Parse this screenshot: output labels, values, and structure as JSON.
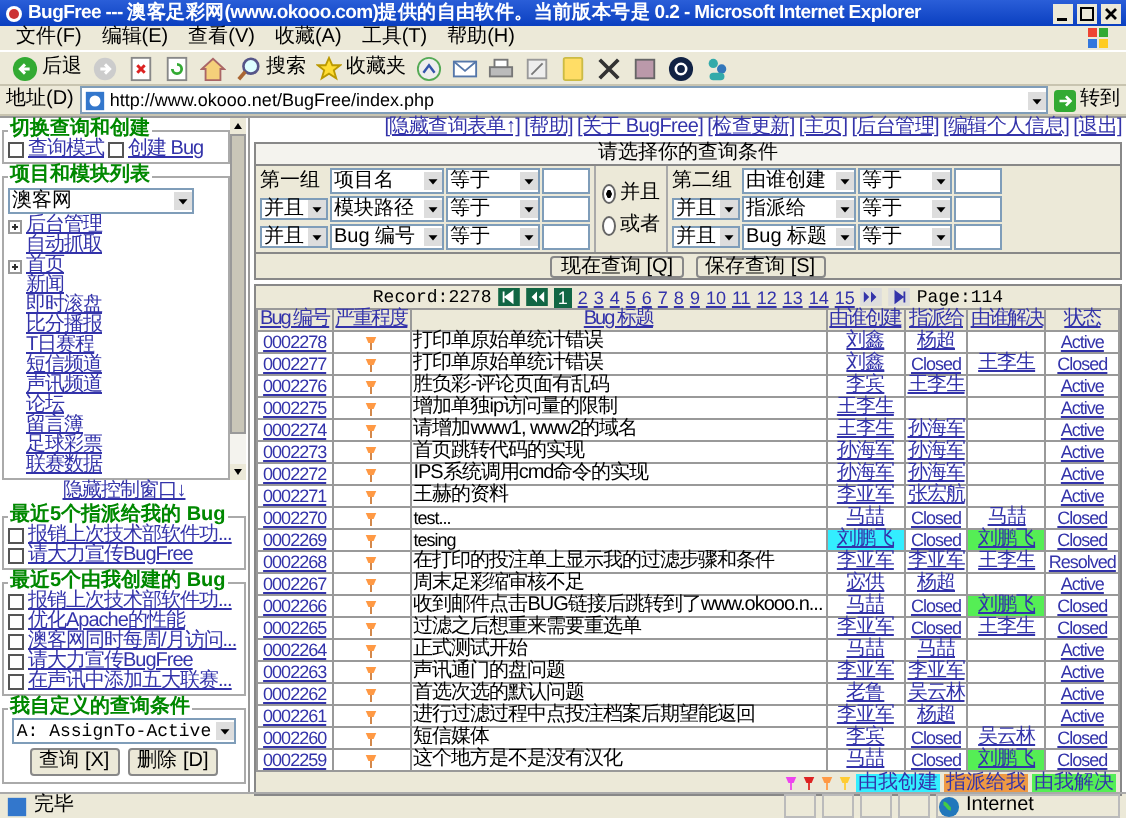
{
  "window": {
    "title": "BugFree --- 澳客足彩网(www.okooo.com)提供的自由软件。当前版本号是 0.2 - Microsoft Internet Explorer"
  },
  "menu": [
    "文件(F)",
    "编辑(E)",
    "查看(V)",
    "收藏(A)",
    "工具(T)",
    "帮助(H)"
  ],
  "toolbar": {
    "back": "后退",
    "search": "搜索",
    "favorites": "收藏夹"
  },
  "address_bar": {
    "label": "地址(D)",
    "url": "http://www.okooo.net/BugFree/index.php",
    "go": "转到"
  },
  "sidebar": {
    "switch_legend": "切换查询和创建",
    "modes": [
      {
        "label": "查询模式",
        "checked": false
      },
      {
        "label": "创建 Bug",
        "checked": false
      }
    ],
    "project_legend": "项目和模块列表",
    "project": "澳客网",
    "modules": [
      {
        "label": "后台管理",
        "kind": "folder"
      },
      {
        "label": "自动抓取",
        "kind": "leaf"
      },
      {
        "label": "首页",
        "kind": "folder"
      },
      {
        "label": "新闻",
        "kind": "leaf"
      },
      {
        "label": "即时滚盘",
        "kind": "leaf"
      },
      {
        "label": "比分播报",
        "kind": "leaf"
      },
      {
        "label": "T日赛程",
        "kind": "leaf"
      },
      {
        "label": "短信频道",
        "kind": "leaf"
      },
      {
        "label": "声讯频道",
        "kind": "leaf"
      },
      {
        "label": "论坛",
        "kind": "leaf"
      },
      {
        "label": "留言簿",
        "kind": "leaf"
      },
      {
        "label": "足球彩票",
        "kind": "leaf"
      },
      {
        "label": "联赛数据",
        "kind": "leaf"
      }
    ],
    "hide_link": "隐藏控制窗口↓",
    "assigned_legend": "最近5个指派给我的 Bug",
    "assigned": [
      {
        "label": "报销上次技术部软件功...",
        "checked": false
      },
      {
        "label": "请大力宣传BugFree",
        "checked": false
      }
    ],
    "created_legend": "最近5个由我创建的 Bug",
    "created": [
      {
        "label": "报销上次技术部软件功...",
        "checked": false
      },
      {
        "label": "优化Apache的性能",
        "checked": false
      },
      {
        "label": "澳客网同时每周/月访问...",
        "checked": false
      },
      {
        "label": "请大力宣传BugFree",
        "checked": false
      },
      {
        "label": "在声讯中添加五大联赛...",
        "checked": false
      }
    ],
    "query_legend": "我自定义的查询条件",
    "saved_query": "A: AssignTo-Active",
    "buttons": [
      "查询 [X]",
      "删除 [D]"
    ]
  },
  "top_links": [
    "[隐藏查询表单↑]",
    "[帮助]",
    "[关于 BugFree]",
    "[检查更新]",
    "[主页]",
    "[后台管理]",
    "[编辑个人信息]",
    "[退出]"
  ],
  "query": {
    "title": "请选择你的查询条件",
    "group1": [
      {
        "kind": "label",
        "lead": "第一组",
        "field": "项目名",
        "operator": "等于"
      },
      {
        "kind": "join",
        "lead": "并且",
        "field": "模块路径",
        "operator": "等于"
      },
      {
        "kind": "join",
        "lead": "并且",
        "field": "Bug 编号",
        "operator": "等于"
      }
    ],
    "logic": [
      {
        "label": "并且",
        "selected": true
      },
      {
        "label": "或者",
        "selected": false
      }
    ],
    "group2": [
      {
        "kind": "label",
        "lead": "第二组",
        "field": "由谁创建",
        "operator": "等于"
      },
      {
        "kind": "join",
        "lead": "并且",
        "field": "指派给",
        "operator": "等于"
      },
      {
        "kind": "join",
        "lead": "并且",
        "field": "Bug 标题",
        "operator": "等于"
      }
    ],
    "buttons": [
      "现在查询 [Q]",
      "保存查询 [S]"
    ]
  },
  "pager": {
    "record": "Record:2278",
    "pages": [
      {
        "label": "1",
        "selected": true
      },
      {
        "label": "2",
        "selected": false
      },
      {
        "label": "3",
        "selected": false
      },
      {
        "label": "4",
        "selected": false
      },
      {
        "label": "5",
        "selected": false
      },
      {
        "label": "6",
        "selected": false
      },
      {
        "label": "7",
        "selected": false
      },
      {
        "label": "8",
        "selected": false
      },
      {
        "label": "9",
        "selected": false
      },
      {
        "label": "10",
        "selected": false
      },
      {
        "label": "11",
        "selected": false
      },
      {
        "label": "12",
        "selected": false
      },
      {
        "label": "13",
        "selected": false
      },
      {
        "label": "14",
        "selected": false
      },
      {
        "label": "15",
        "selected": false
      }
    ],
    "page": "Page:114"
  },
  "table": {
    "columns": [
      "Bug 编号",
      "严重程度",
      "Bug 标题",
      "由谁创建",
      "指派给",
      "由谁解决",
      "状态"
    ],
    "rows": [
      {
        "id": "0002278",
        "title": "打印单原始单统计错误",
        "created_by": "刘鑫",
        "created_by_me": false,
        "assigned_to": "杨超",
        "resolved_by_me": false,
        "status": "Active"
      },
      {
        "id": "0002277",
        "title": "打印单原始单统计错误",
        "created_by": "刘鑫",
        "created_by_me": false,
        "assigned_to": "Closed",
        "resolved_by": "王李生",
        "resolved_by_me": false,
        "status": "Closed"
      },
      {
        "id": "0002276",
        "title": "胜负彩-评论页面有乱码",
        "created_by": "李宾",
        "created_by_me": false,
        "assigned_to": "王李生",
        "resolved_by_me": false,
        "status": "Active"
      },
      {
        "id": "0002275",
        "title": "增加单独ip访问量的限制",
        "created_by": "王李生",
        "created_by_me": false,
        "resolved_by_me": false,
        "status": "Active"
      },
      {
        "id": "0002274",
        "title": "请增加www1, www2的域名",
        "created_by": "王李生",
        "created_by_me": false,
        "assigned_to": "孙海军",
        "resolved_by_me": false,
        "status": "Active"
      },
      {
        "id": "0002273",
        "title": "首页跳转代码的实现",
        "created_by": "孙海军",
        "created_by_me": false,
        "assigned_to": "孙海军",
        "resolved_by_me": false,
        "status": "Active"
      },
      {
        "id": "0002272",
        "title": "IPS系统调用cmd命令的实现",
        "created_by": "孙海军",
        "created_by_me": false,
        "assigned_to": "孙海军",
        "resolved_by_me": false,
        "status": "Active"
      },
      {
        "id": "0002271",
        "title": "王赫的资料",
        "created_by": "李亚军",
        "created_by_me": false,
        "assigned_to": "张宏航",
        "resolved_by_me": false,
        "status": "Active"
      },
      {
        "id": "0002270",
        "title": "test...",
        "created_by": "马喆",
        "created_by_me": false,
        "assigned_to": "Closed",
        "resolved_by": "马喆",
        "resolved_by_me": false,
        "status": "Closed"
      },
      {
        "id": "0002269",
        "title": "tesing",
        "created_by": "刘鹏飞",
        "created_by_me": true,
        "assigned_to": "Closed",
        "resolved_by": "刘鹏飞",
        "resolved_by_me": true,
        "status": "Closed"
      },
      {
        "id": "0002268",
        "title": "在打印的投注单上显示我的过滤步骤和条件",
        "created_by": "李亚军",
        "created_by_me": false,
        "assigned_to": "李亚军",
        "resolved_by": "王李生",
        "resolved_by_me": false,
        "status": "Resolved"
      },
      {
        "id": "0002267",
        "title": "周末足彩缩审核不足",
        "created_by": "宓供",
        "created_by_me": false,
        "assigned_to": "杨超",
        "resolved_by_me": false,
        "status": "Active"
      },
      {
        "id": "0002266",
        "title": "收到邮件点击BUG链接后跳转到了www.okooo.n...",
        "created_by": "马喆",
        "created_by_me": false,
        "assigned_to": "Closed",
        "resolved_by": "刘鹏飞",
        "resolved_by_me": true,
        "status": "Closed"
      },
      {
        "id": "0002265",
        "title": "过滤之后想重来需要重选单",
        "created_by": "李亚军",
        "created_by_me": false,
        "assigned_to": "Closed",
        "resolved_by": "王李生",
        "resolved_by_me": false,
        "status": "Closed"
      },
      {
        "id": "0002264",
        "title": "正式测试开始",
        "created_by": "马喆",
        "created_by_me": false,
        "assigned_to": "马喆",
        "resolved_by_me": false,
        "status": "Active"
      },
      {
        "id": "0002263",
        "title": "声讯通门的盘问题",
        "created_by": "李亚军",
        "created_by_me": false,
        "assigned_to": "李亚军",
        "resolved_by_me": false,
        "status": "Active"
      },
      {
        "id": "0002262",
        "title": "首选次选的默认问题",
        "created_by": "老鲁",
        "created_by_me": false,
        "assigned_to": "吴云林",
        "resolved_by_me": false,
        "status": "Active"
      },
      {
        "id": "0002261",
        "title": "进行过滤过程中点投注档案后期望能返回",
        "created_by": "李亚军",
        "created_by_me": false,
        "assigned_to": "杨超",
        "resolved_by_me": false,
        "status": "Active"
      },
      {
        "id": "0002260",
        "title": "短信媒体",
        "created_by": "李宾",
        "created_by_me": false,
        "assigned_to": "Closed",
        "resolved_by": "吴云林",
        "resolved_by_me": false,
        "status": "Closed"
      },
      {
        "id": "0002259",
        "title": "这个地方是不是没有汉化",
        "created_by": "马喆",
        "created_by_me": false,
        "assigned_to": "Closed",
        "resolved_by": "刘鹏飞",
        "resolved_by_me": true,
        "status": "Closed"
      }
    ]
  },
  "legend": {
    "severities": [
      {
        "color": "#ee44ee"
      },
      {
        "color": "#dd2222"
      },
      {
        "color": "#ff9944"
      },
      {
        "color": "#ffcc33"
      }
    ],
    "marks": [
      {
        "label": "由我创建",
        "color": "#33eeff"
      },
      {
        "label": "指派给我",
        "color": "#ee9944"
      },
      {
        "label": "由我解决",
        "color": "#55ee55"
      }
    ]
  },
  "status_bar": {
    "text": "完毕",
    "zone": "Internet"
  }
}
